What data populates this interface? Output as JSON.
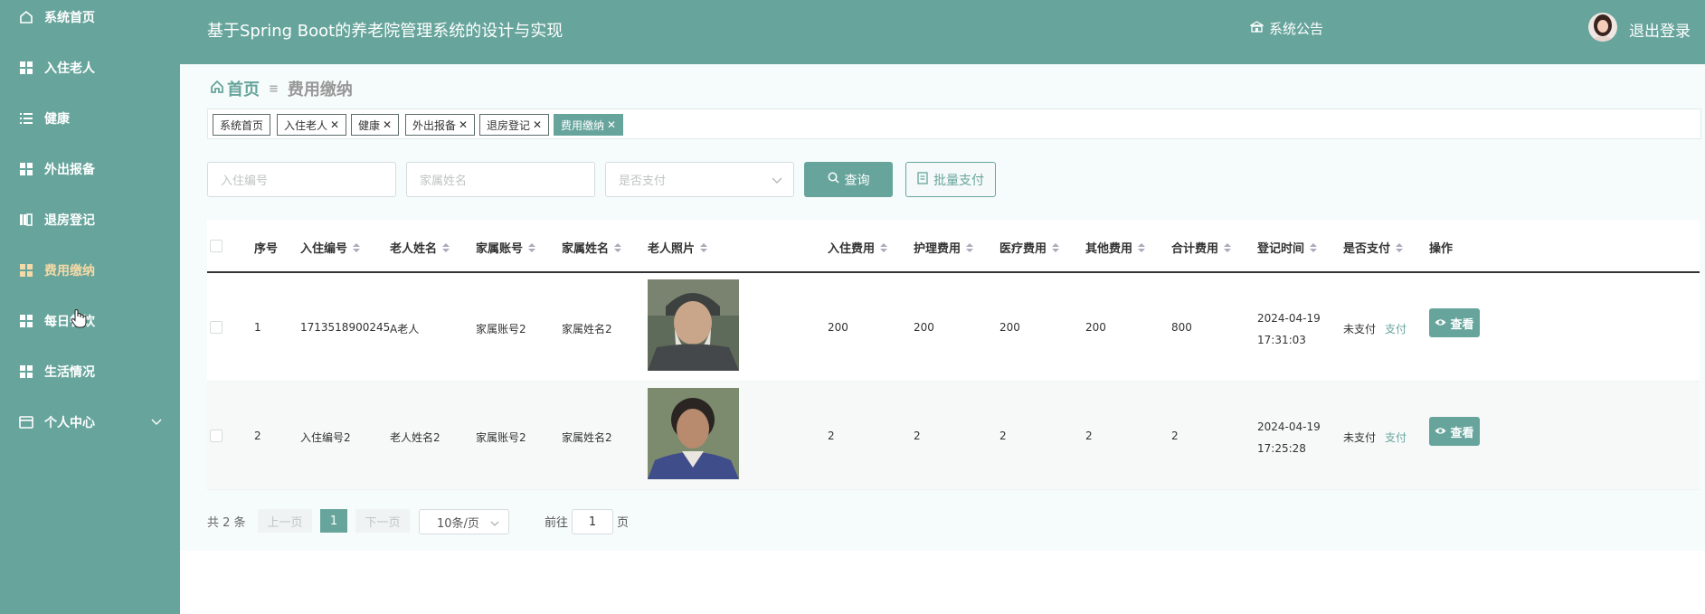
{
  "sidebar": {
    "items": [
      {
        "label": "系统首页",
        "icon": "home-icon"
      },
      {
        "label": "入住老人",
        "icon": "grid-icon"
      },
      {
        "label": "健康",
        "icon": "list-icon"
      },
      {
        "label": "外出报备",
        "icon": "grid-icon"
      },
      {
        "label": "退房登记",
        "icon": "book-icon"
      },
      {
        "label": "费用缴纳",
        "icon": "grid-icon",
        "active": true
      },
      {
        "label": "每日餐饮",
        "icon": "grid-icon"
      },
      {
        "label": "生活情况",
        "icon": "grid-icon"
      },
      {
        "label": "个人中心",
        "icon": "id-card-icon"
      }
    ]
  },
  "header": {
    "title": "基于Spring Boot的养老院管理系统的设计与实现",
    "notice": "系统公告",
    "logout": "退出登录"
  },
  "breadcrumb": {
    "home": "首页",
    "current": "费用缴纳"
  },
  "tags": [
    "系统首页",
    "入住老人",
    "健康",
    "外出报备",
    "退房登记",
    "费用缴纳"
  ],
  "search": {
    "checkin_no_placeholder": "入住编号",
    "family_name_placeholder": "家属姓名",
    "paid_placeholder": "是否支付",
    "query_label": "查询",
    "batch_pay_label": "批量支付"
  },
  "table": {
    "columns": [
      "序号",
      "入住编号",
      "老人姓名",
      "家属账号",
      "家属姓名",
      "老人照片",
      "入住费用",
      "护理费用",
      "医疗费用",
      "其他费用",
      "合计费用",
      "登记时间",
      "是否支付",
      "操作"
    ],
    "rows": [
      {
        "index": "1",
        "checkin_no": "1713518900245",
        "elder_name": "A老人",
        "family_account": "家属账号2",
        "family_name": "家属姓名2",
        "checkin_fee": "200",
        "nursing_fee": "200",
        "medical_fee": "200",
        "other_fee": "200",
        "total_fee": "800",
        "time": "2024-04-19 17:31:03",
        "paid_status": "未支付",
        "pay_link": "支付",
        "view_label": "查看"
      },
      {
        "index": "2",
        "checkin_no": "入住编号2",
        "elder_name": "老人姓名2",
        "family_account": "家属账号2",
        "family_name": "家属姓名2",
        "checkin_fee": "2",
        "nursing_fee": "2",
        "medical_fee": "2",
        "other_fee": "2",
        "total_fee": "2",
        "time": "2024-04-19 17:25:28",
        "paid_status": "未支付",
        "pay_link": "支付",
        "view_label": "查看"
      }
    ]
  },
  "pagination": {
    "total": "共 2 条",
    "prev": "上一页",
    "page": "1",
    "next": "下一页",
    "page_size": "10条/页",
    "goto_label": "前往",
    "goto_value": "1",
    "page_unit": "页"
  },
  "colors": {
    "primary": "#67a59c",
    "active_menu": "#f5d9a6"
  }
}
